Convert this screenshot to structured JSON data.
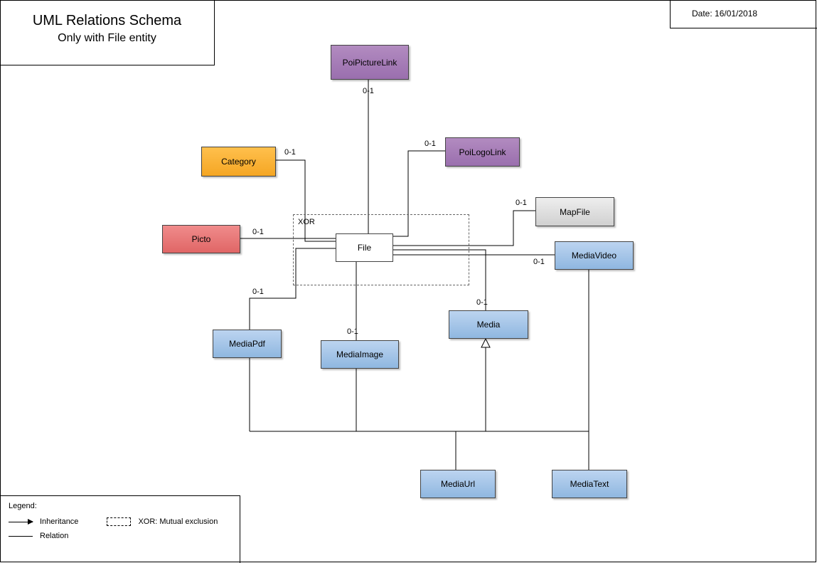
{
  "header": {
    "title": "UML Relations Schema",
    "subtitle": "Only with File entity",
    "date_label": "Date: 16/01/2018"
  },
  "entities": {
    "poi_picture_link": "PoiPictureLink",
    "poi_logo_link": "PoiLogoLink",
    "category": "Category",
    "picto": "Picto",
    "map_file": "MapFile",
    "media_video": "MediaVideo",
    "file": "File",
    "media_pdf": "MediaPdf",
    "media_image": "MediaImage",
    "media": "Media",
    "media_url": "MediaUrl",
    "media_text": "MediaText"
  },
  "xor_label": "XOR",
  "cardinalities": {
    "c_poi_picture_link": "0-1",
    "c_category": "0-1",
    "c_poi_logo_link": "0-1",
    "c_picto": "0-1",
    "c_map_file": "0-1",
    "c_media_video": "0-1",
    "c_media_pdf": "0-1",
    "c_media_image": "0-1",
    "c_media": "0-1"
  },
  "legend": {
    "title": "Legend:",
    "inheritance": "Inheritance",
    "relation": "Relation",
    "xor": "XOR: Mutual exclusion"
  }
}
